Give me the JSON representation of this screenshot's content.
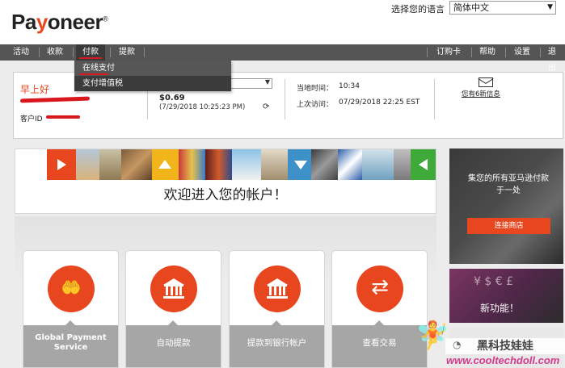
{
  "brand": {
    "logo": "Payoneer",
    "accent": "#e8461e"
  },
  "header": {
    "language_label": "选择您的语言",
    "language_value": "简体中文"
  },
  "nav": {
    "items": [
      "活动",
      "收款",
      "付款",
      "提款",
      "订购卡",
      "帮助",
      "设置",
      "退出"
    ],
    "active": "付款"
  },
  "dropdown": {
    "items": [
      "在线支付",
      "支付增值税"
    ]
  },
  "account": {
    "greeting": "早上好",
    "customer_id_label": "客户ID",
    "balance": "$0.69",
    "balance_time": "(7/29/2018 10:25:23 PM)",
    "local_time_label": "当地时间：",
    "local_time_value": "10:34",
    "last_visit_label": "上次访问：",
    "last_visit_value": "07/29/2018 22:25 EST",
    "messages_link": "您有6新信息"
  },
  "banner": {
    "title": "欢迎进入您的帐户！"
  },
  "tiles": [
    {
      "icon": "hand-coin-icon",
      "label": "Global Payment Service"
    },
    {
      "icon": "bank-icon",
      "label": "自动提款"
    },
    {
      "icon": "bank-icon",
      "label": "提款到银行帐户"
    },
    {
      "icon": "exchange-arrows-icon",
      "label": "查看交易"
    }
  ],
  "ads": {
    "amazon_text": "集您的所有亚马逊付款于一处",
    "amazon_button": "连接商店",
    "new_feature": "新功能！"
  },
  "watermark": {
    "title": "黑科技娃娃",
    "url": "www.cooltechdoll.com"
  }
}
